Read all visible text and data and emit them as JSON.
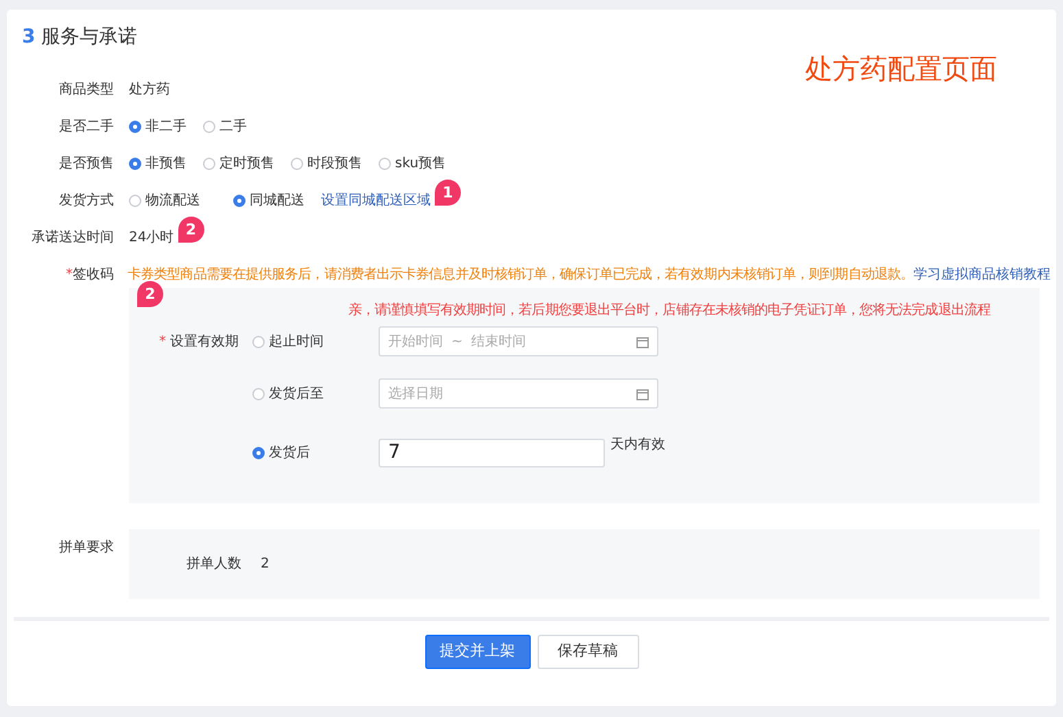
{
  "section": {
    "number": "3",
    "title": "服务与承诺"
  },
  "overlay_title": "处方药配置页面",
  "fields": [
    {
      "kind": "text",
      "label": "商品类型",
      "value": "处方药"
    },
    {
      "kind": "radio",
      "label": "是否二手",
      "options": [
        {
          "label": "非二手",
          "selected": true
        },
        {
          "label": "二手",
          "selected": false
        }
      ]
    },
    {
      "kind": "radio",
      "label": "是否预售",
      "options": [
        {
          "label": "非预售",
          "selected": true
        },
        {
          "label": "定时预售",
          "selected": false
        },
        {
          "label": "时段预售",
          "selected": false
        },
        {
          "label": "sku预售",
          "selected": false
        }
      ]
    },
    {
      "kind": "radio",
      "label": "发货方式",
      "options": [
        {
          "label": "物流配送",
          "selected": false
        },
        {
          "label": "同城配送",
          "selected": true
        }
      ],
      "link": "设置同城配送区域",
      "marker": "1"
    },
    {
      "kind": "text",
      "label": "承诺送达时间",
      "value": "24小时",
      "marker": "2"
    }
  ],
  "code": {
    "label": "签收码",
    "required_mark": "*",
    "notice": "卡券类型商品需要在提供服务后，请消费者出示卡券信息并及时核销订单，确保订单已完成，若有效期内未核销订单，则到期自动退款。",
    "link": "学习虚拟商品核销教程",
    "marker": "2",
    "warning": "亲，请谨慎填写有效期时间，若后期您要退出平台时，店铺存在未核销的电子凭证订单，您将无法完成退出流程",
    "validity_label": "设置有效期",
    "validity_required_mark": "*",
    "options": [
      {
        "kind": "range",
        "label": "起止时间",
        "selected": false,
        "start_placeholder": "开始时间",
        "separator": "~",
        "end_placeholder": "结束时间"
      },
      {
        "kind": "date",
        "label": "发货后至",
        "selected": false,
        "placeholder": "选择日期"
      },
      {
        "kind": "days",
        "label": "发货后",
        "selected": true,
        "value": "7",
        "suffix": "天内有效"
      }
    ]
  },
  "group": {
    "label": "拼单要求",
    "field_label": "拼单人数",
    "value": "2"
  },
  "buttons": [
    {
      "label": "提交并上架",
      "primary": true
    },
    {
      "label": "保存草稿",
      "primary": false
    }
  ]
}
